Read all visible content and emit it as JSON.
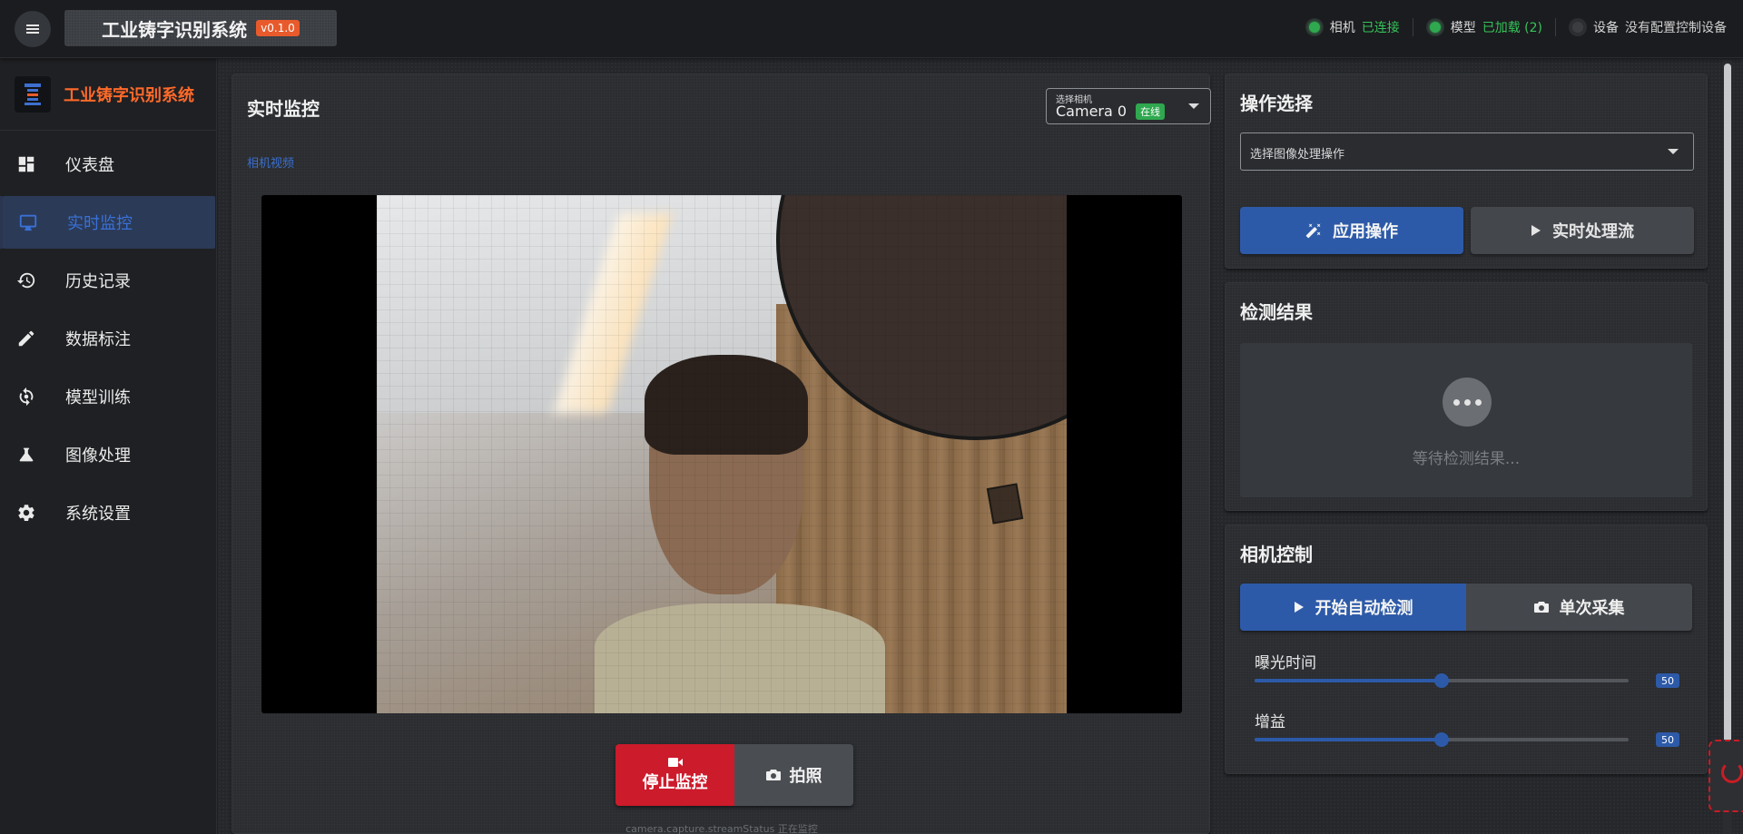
{
  "header": {
    "app_title": "工业铸字识别系统",
    "version": "v0.1.0",
    "status": [
      {
        "label": "相机",
        "value": "已连接",
        "state": "on"
      },
      {
        "label": "模型",
        "value": "已加载 (2)",
        "state": "on"
      },
      {
        "label": "设备",
        "value": "没有配置控制设备",
        "state": "off"
      }
    ]
  },
  "sidebar": {
    "brand": "工业铸字识别系统",
    "items": [
      {
        "label": "仪表盘",
        "icon": "dashboard-icon"
      },
      {
        "label": "实时监控",
        "icon": "monitor-icon",
        "active": true
      },
      {
        "label": "历史记录",
        "icon": "history-icon"
      },
      {
        "label": "数据标注",
        "icon": "pencil-icon"
      },
      {
        "label": "模型训练",
        "icon": "training-icon"
      },
      {
        "label": "图像处理",
        "icon": "flask-icon"
      },
      {
        "label": "系统设置",
        "icon": "gear-icon"
      }
    ]
  },
  "monitor": {
    "title": "实时监控",
    "camera_select_caption": "选择相机",
    "camera_name": "Camera 0",
    "camera_badge": "在线",
    "video_label": "相机视频",
    "stop_label": "停止监控",
    "photo_label": "拍照",
    "stream_status": "camera.capture.streamStatus 正在监控"
  },
  "operation": {
    "title": "操作选择",
    "select_placeholder": "选择图像处理操作",
    "apply_label": "应用操作",
    "stream_label": "实时处理流"
  },
  "detection": {
    "title": "检测结果",
    "waiting_text": "等待检测结果..."
  },
  "camera_control": {
    "title": "相机控制",
    "auto_label": "开始自动检测",
    "single_label": "单次采集",
    "exposure_label": "曝光时间",
    "exposure_value": "50",
    "gain_label": "增益",
    "gain_value": "50"
  },
  "colors": {
    "accent": "#2d5aa8",
    "brand": "#ff6a2a",
    "danger": "#cc1b2b",
    "success": "#2fa84f"
  }
}
